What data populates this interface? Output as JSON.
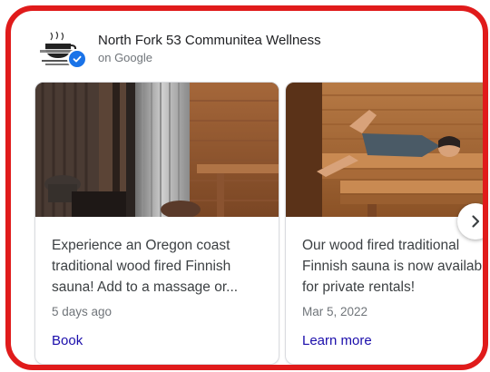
{
  "business": {
    "name": "North Fork 53 Communitea Wellness",
    "source": "on Google",
    "logo_icon": "teacup-logo-icon",
    "verified_icon": "verified-check-icon"
  },
  "posts": [
    {
      "description": "Experience an Oregon coast\ntraditional wood fired Finnish\nsauna! Add to a massage or...",
      "date": "5 days ago",
      "cta": "Book",
      "image_icon": "sauna-interior-image"
    },
    {
      "description": "Our wood fired traditional\nFinnish sauna is now availab\nfor private rentals!",
      "date": "Mar 5, 2022",
      "cta": "Learn more",
      "image_icon": "sauna-person-image"
    }
  ],
  "carousel": {
    "next_icon": "chevron-right-icon"
  },
  "colors": {
    "highlight_border": "#e01b1b",
    "link": "#1a0dab",
    "verified": "#1a73e8"
  }
}
